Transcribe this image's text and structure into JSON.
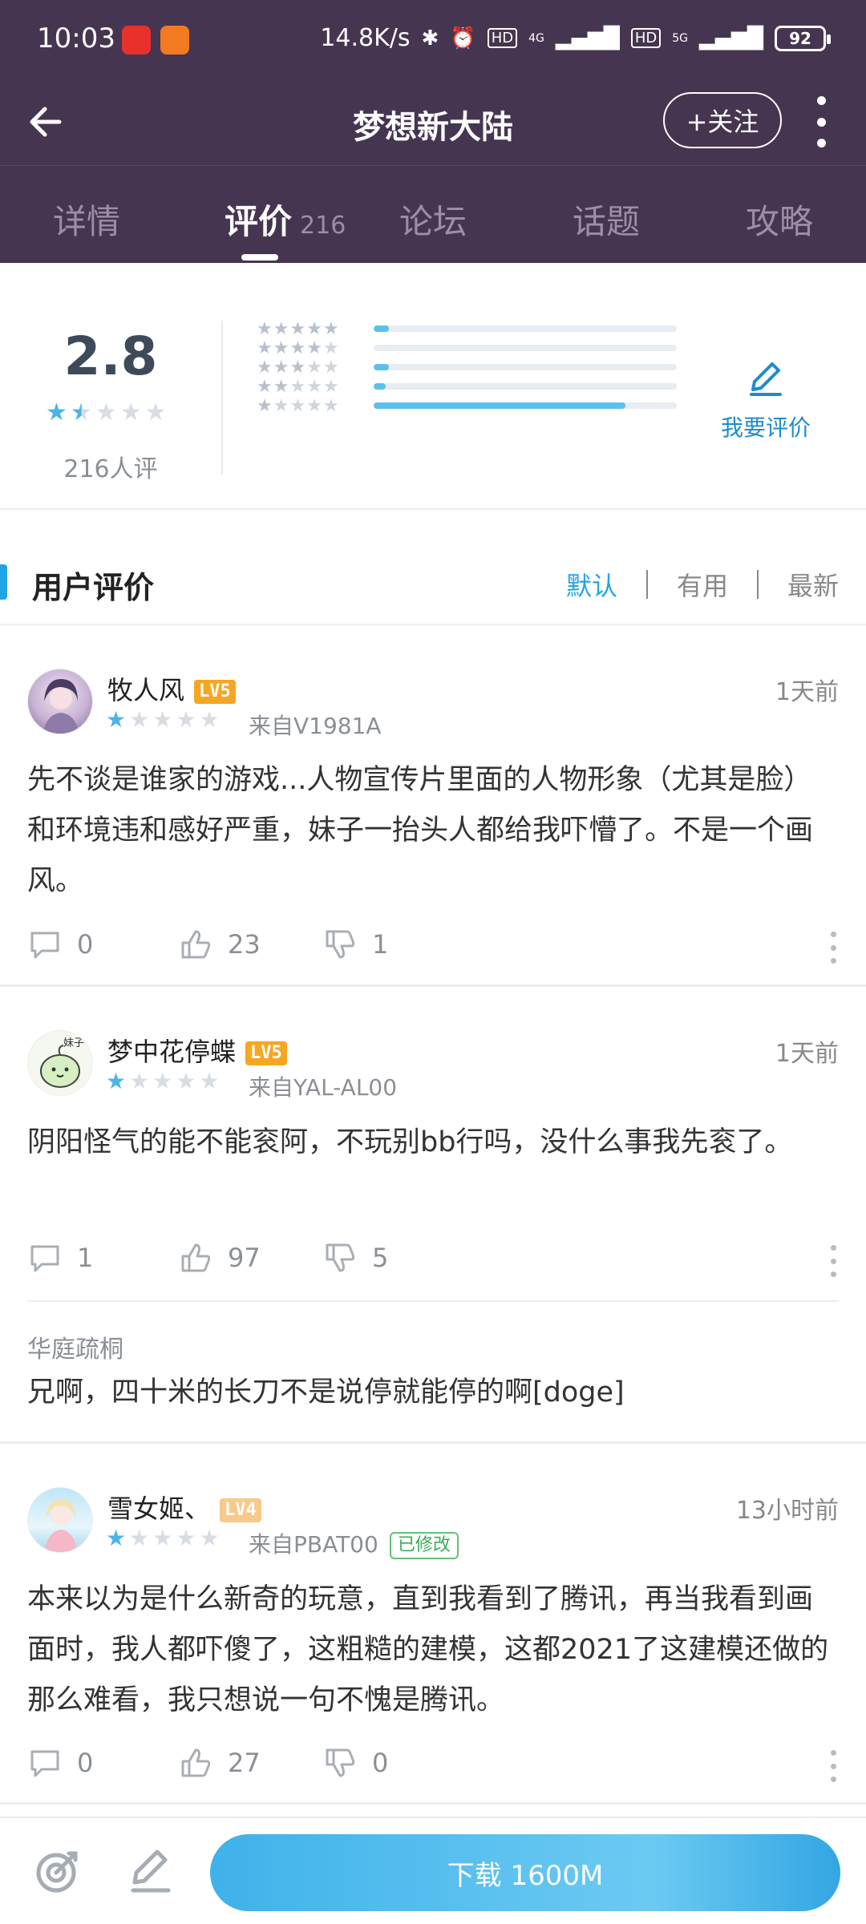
{
  "status": {
    "time": "10:03",
    "speed": "14.8K/s",
    "battery": "92",
    "hd1": "HD",
    "hd2": "HD",
    "net1": "4G",
    "net2": "5G"
  },
  "header": {
    "title": "梦想新大陆",
    "follow_label": "+关注"
  },
  "tabs": [
    {
      "label": "详情"
    },
    {
      "label": "评价",
      "count": "216"
    },
    {
      "label": "论坛"
    },
    {
      "label": "话题"
    },
    {
      "label": "攻略"
    }
  ],
  "summary": {
    "score": "2.8",
    "star_value": 1.5,
    "rater_count": "216人评",
    "distribution": [
      {
        "stars": 5,
        "fraction": 0.05
      },
      {
        "stars": 4,
        "fraction": 0.0
      },
      {
        "stars": 3,
        "fraction": 0.05
      },
      {
        "stars": 2,
        "fraction": 0.04
      },
      {
        "stars": 1,
        "fraction": 0.83
      }
    ],
    "write_review_label": "我要评价"
  },
  "section": {
    "title": "用户评价",
    "sort_options": [
      "默认",
      "有用",
      "最新"
    ],
    "active_sort": "默认"
  },
  "reviews": [
    {
      "username": "牧人风",
      "level": "LV5",
      "time": "1天前",
      "stars": 1,
      "device": "来自V1981A",
      "content": "先不谈是谁家的游戏...人物宣传片里面的人物形象（尤其是脸）和环境违和感好严重，妹子一抬头人都给我吓懵了。不是一个画风。",
      "comments": "0",
      "likes": "23",
      "dislikes": "1"
    },
    {
      "username": "梦中花停蝶",
      "level": "LV5",
      "time": "1天前",
      "stars": 1,
      "device": "来自YAL-AL00",
      "content": "阴阳怪气的能不能衮阿，不玩别bb行吗，没什么事我先衮了。",
      "comments": "1",
      "likes": "97",
      "dislikes": "5",
      "avatar_text": "妹子",
      "reply": {
        "user": "华庭疏桐",
        "text": "兄啊，四十米的长刀不是说停就能停的啊[doge]"
      }
    },
    {
      "username": "雪女姬、",
      "level": "LV4",
      "time": "13小时前",
      "stars": 1,
      "device": "来自PBAT00",
      "edited_label": "已修改",
      "content": "本来以为是什么新奇的玩意，直到我看到了腾讯，再当我看到画面时，我人都吓傻了，这粗糙的建模，这都2021了这建模还做的那么难看，我只想说一句不愧是腾讯。",
      "comments": "0",
      "likes": "27",
      "dislikes": "0"
    }
  ],
  "bottom": {
    "download_label": "下载 1600M"
  },
  "colors": {
    "header_bg": "#463550",
    "accent_blue": "#1fa5e6",
    "star_on": "#4cb4e6",
    "level_badge": "#f6a623"
  }
}
